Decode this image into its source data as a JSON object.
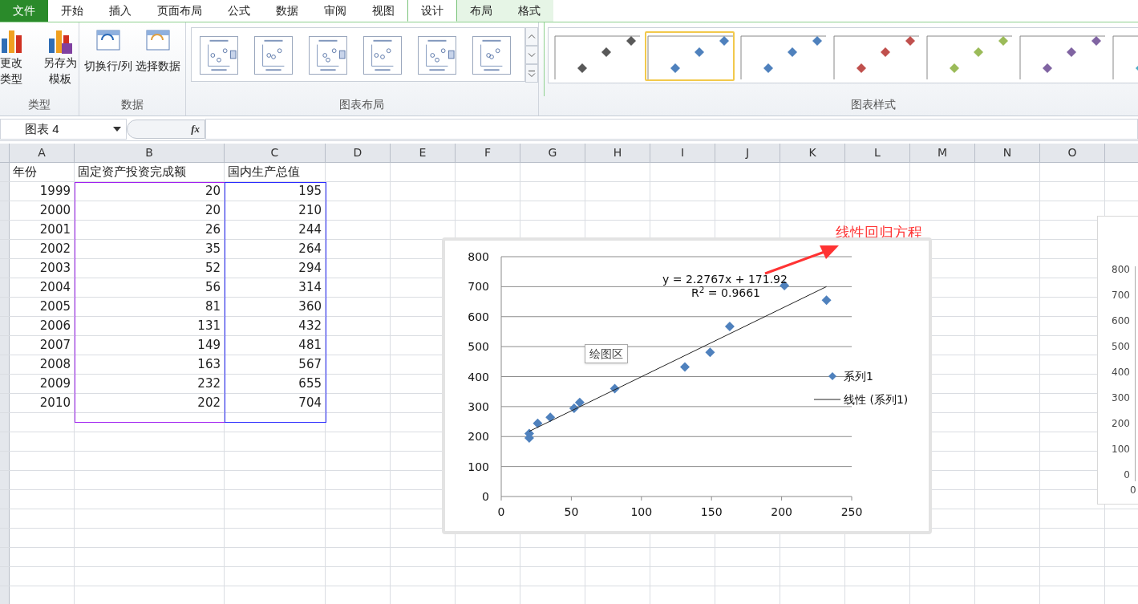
{
  "tabs": [
    {
      "label": "文件",
      "kind": "file",
      "selected": false
    },
    {
      "label": "开始",
      "kind": "normal",
      "selected": false
    },
    {
      "label": "插入",
      "kind": "normal",
      "selected": false
    },
    {
      "label": "页面布局",
      "kind": "normal",
      "selected": false
    },
    {
      "label": "公式",
      "kind": "normal",
      "selected": false
    },
    {
      "label": "数据",
      "kind": "normal",
      "selected": false
    },
    {
      "label": "审阅",
      "kind": "normal",
      "selected": false
    },
    {
      "label": "视图",
      "kind": "normal",
      "selected": false
    },
    {
      "label": "设计",
      "kind": "context",
      "selected": true
    },
    {
      "label": "布局",
      "kind": "context",
      "selected": false
    },
    {
      "label": "格式",
      "kind": "context",
      "selected": false
    }
  ],
  "ribbon": {
    "type_group": {
      "label": "类型",
      "buttons": [
        {
          "lines": [
            "更改",
            "类型"
          ],
          "kind": "chart"
        },
        {
          "lines": [
            "另存为",
            "模板"
          ],
          "kind": "template"
        }
      ]
    },
    "data_group": {
      "label": "数据",
      "buttons": [
        {
          "label": "切换行/列",
          "kind": "switch"
        },
        {
          "label": "选择数据",
          "kind": "select"
        }
      ]
    },
    "layout_group": {
      "label": "图表布局"
    },
    "style_group": {
      "label": "图表样式",
      "styles": [
        {
          "color": "#595959",
          "selected": false
        },
        {
          "color": "#4f81bd",
          "selected": true
        },
        {
          "color": "#4f81bd",
          "selected": false
        },
        {
          "color": "#c0504d",
          "selected": false
        },
        {
          "color": "#9bbb59",
          "selected": false
        },
        {
          "color": "#8064a2",
          "selected": false
        },
        {
          "color": "#4bacc6",
          "selected": false
        }
      ]
    }
  },
  "name_box": "图表 4",
  "function_button": "fx",
  "table": {
    "columns": [
      {
        "label": "A"
      },
      {
        "label": "B",
        "color": "#a020f0"
      },
      {
        "label": "C",
        "color": "#2a2aff"
      },
      {
        "label": "D"
      },
      {
        "label": "E"
      },
      {
        "label": "F"
      },
      {
        "label": "G"
      },
      {
        "label": "H"
      },
      {
        "label": "I"
      },
      {
        "label": "J"
      },
      {
        "label": "K"
      },
      {
        "label": "L"
      },
      {
        "label": "M"
      },
      {
        "label": "N"
      },
      {
        "label": "O"
      }
    ],
    "header": [
      "年份",
      "固定资产投资完成额",
      "国内生产总值"
    ],
    "rows": [
      [
        "1999",
        "20",
        "195"
      ],
      [
        "2000",
        "20",
        "210"
      ],
      [
        "2001",
        "26",
        "244"
      ],
      [
        "2002",
        "35",
        "264"
      ],
      [
        "2003",
        "52",
        "294"
      ],
      [
        "2004",
        "56",
        "314"
      ],
      [
        "2005",
        "81",
        "360"
      ],
      [
        "2006",
        "131",
        "432"
      ],
      [
        "2007",
        "149",
        "481"
      ],
      [
        "2008",
        "163",
        "567"
      ],
      [
        "2009",
        "232",
        "655"
      ],
      [
        "2010",
        "202",
        "704"
      ]
    ]
  },
  "chart": {
    "tooltip": "绘图区",
    "trendline_legend": "线性 (系列1)",
    "chart_data": {
      "type": "scatter",
      "x": [
        20,
        20,
        26,
        35,
        52,
        56,
        81,
        131,
        149,
        163,
        232,
        202
      ],
      "series": [
        {
          "name": "系列1",
          "color": "#4f81bd",
          "values": [
            195,
            210,
            244,
            264,
            294,
            314,
            360,
            432,
            481,
            567,
            655,
            704
          ]
        }
      ],
      "grid": true,
      "xlim": [
        0,
        250
      ],
      "ylim": [
        0,
        800
      ],
      "xticks": [
        0,
        50,
        100,
        150,
        200,
        250
      ],
      "yticks": [
        0,
        100,
        200,
        300,
        400,
        500,
        600,
        700,
        800
      ],
      "annotations": [
        "y = 2.2767x + 171.92",
        "R$^{2}$ = 0.9661"
      ]
    }
  },
  "annotation": {
    "text": "线性回归方程",
    "color": "#ff3333"
  },
  "second_chart": {
    "yticks": [
      "800",
      "700",
      "600",
      "500",
      "400",
      "300",
      "200",
      "100",
      "0"
    ],
    "xtick": "0"
  }
}
